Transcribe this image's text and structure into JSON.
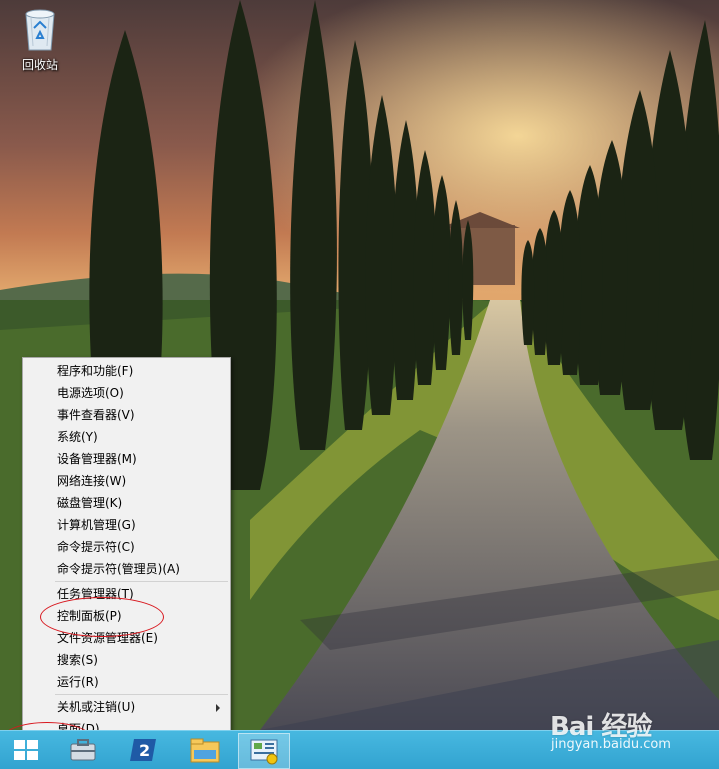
{
  "desktop": {
    "recycle_bin_label": "回收站",
    "recycle_bin_icon": "recycle-bin-icon"
  },
  "context_menu": {
    "groups": [
      [
        "程序和功能(F)",
        "电源选项(O)",
        "事件查看器(V)",
        "系统(Y)",
        "设备管理器(M)",
        "网络连接(W)",
        "磁盘管理(K)",
        "计算机管理(G)",
        "命令提示符(C)",
        "命令提示符(管理员)(A)"
      ],
      [
        "任务管理器(T)",
        "控制面板(P)",
        "文件资源管理器(E)",
        "搜索(S)",
        "运行(R)"
      ],
      [
        "关机或注销(U)",
        "桌面(D)"
      ]
    ],
    "submenu_item": "关机或注销(U)",
    "highlighted_item": "控制面板(P)"
  },
  "taskbar": {
    "start_icon": "windows-logo-icon",
    "pinned": [
      {
        "name": "server-manager-icon"
      },
      {
        "name": "powershell-icon"
      },
      {
        "name": "file-explorer-icon"
      },
      {
        "name": "control-panel-icon"
      }
    ],
    "color": "#39acd8"
  },
  "annotation_color": "#d8181f",
  "watermark": {
    "logo_text": "Bai 经验",
    "url": "jingyan.baidu.com"
  }
}
